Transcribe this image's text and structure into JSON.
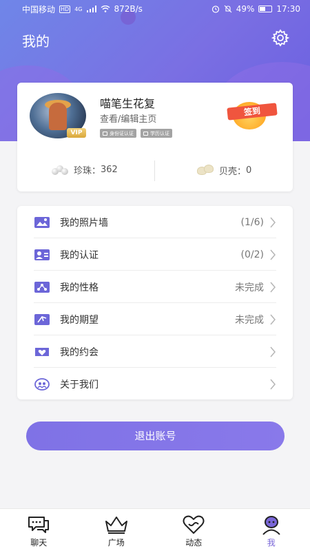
{
  "status_bar": {
    "carrier": "中国移动",
    "network_badge": "HD",
    "signal": "4G",
    "speed": "872B/s",
    "battery": "49%",
    "time": "17:30"
  },
  "header": {
    "title": "我的",
    "settings_icon": "gear-icon"
  },
  "profile": {
    "username": "喵笔生花复",
    "view_edit": "查看/编辑主页",
    "vip_label": "VIP",
    "badges": [
      "身份证认证",
      "学历认证"
    ],
    "sign_in_label": "签到",
    "pearl_label": "珍珠：",
    "pearl_count": "362",
    "shell_label": "贝壳：",
    "shell_count": "0"
  },
  "menu": {
    "items": [
      {
        "label": "我的照片墙",
        "value": "(1/6)",
        "icon": "photo-wall-icon"
      },
      {
        "label": "我的认证",
        "value": "(0/2)",
        "icon": "verification-icon"
      },
      {
        "label": "我的性格",
        "value": "未完成",
        "icon": "personality-icon"
      },
      {
        "label": "我的期望",
        "value": "未完成",
        "icon": "expectation-icon"
      },
      {
        "label": "我的约会",
        "value": "",
        "icon": "date-icon"
      },
      {
        "label": "关于我们",
        "value": "",
        "icon": "about-icon"
      }
    ]
  },
  "logout_label": "退出账号",
  "tabbar": {
    "tabs": [
      {
        "label": "聊天",
        "icon": "chat-icon"
      },
      {
        "label": "广场",
        "icon": "crown-icon"
      },
      {
        "label": "动态",
        "icon": "heart-icon"
      },
      {
        "label": "我",
        "icon": "profile-icon"
      }
    ],
    "active": "我"
  },
  "colors": {
    "accent": "#7a67d8",
    "header_gradient_start": "#6f86e8",
    "header_gradient_end": "#6a5fe0",
    "sign_in_ribbon": "#f0553e"
  }
}
